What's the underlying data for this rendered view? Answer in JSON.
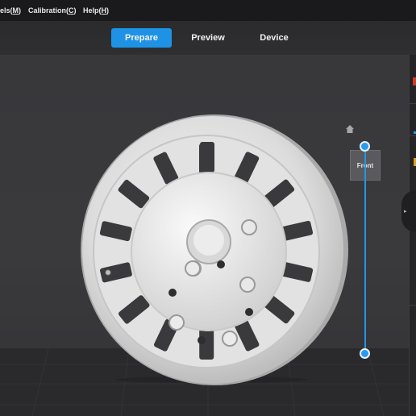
{
  "menu": {
    "models_label": "els(M)",
    "models_text": "els(",
    "models_key": "M",
    "calibration_text": "Calibration(",
    "calibration_key": "C",
    "help_text": "Help(",
    "help_key": "H"
  },
  "tabs": [
    {
      "label": "Prepare",
      "active": true
    },
    {
      "label": "Preview",
      "active": false
    },
    {
      "label": "Device",
      "active": false
    }
  ],
  "viewport": {
    "view_button": "Front",
    "home_icon": "home-icon",
    "layer_slider": {
      "upper": 1.0,
      "lower": 0.0
    }
  },
  "colors": {
    "accent": "#1e93e6",
    "background": "#2b2b2e",
    "menubar": "#1a1a1c"
  }
}
